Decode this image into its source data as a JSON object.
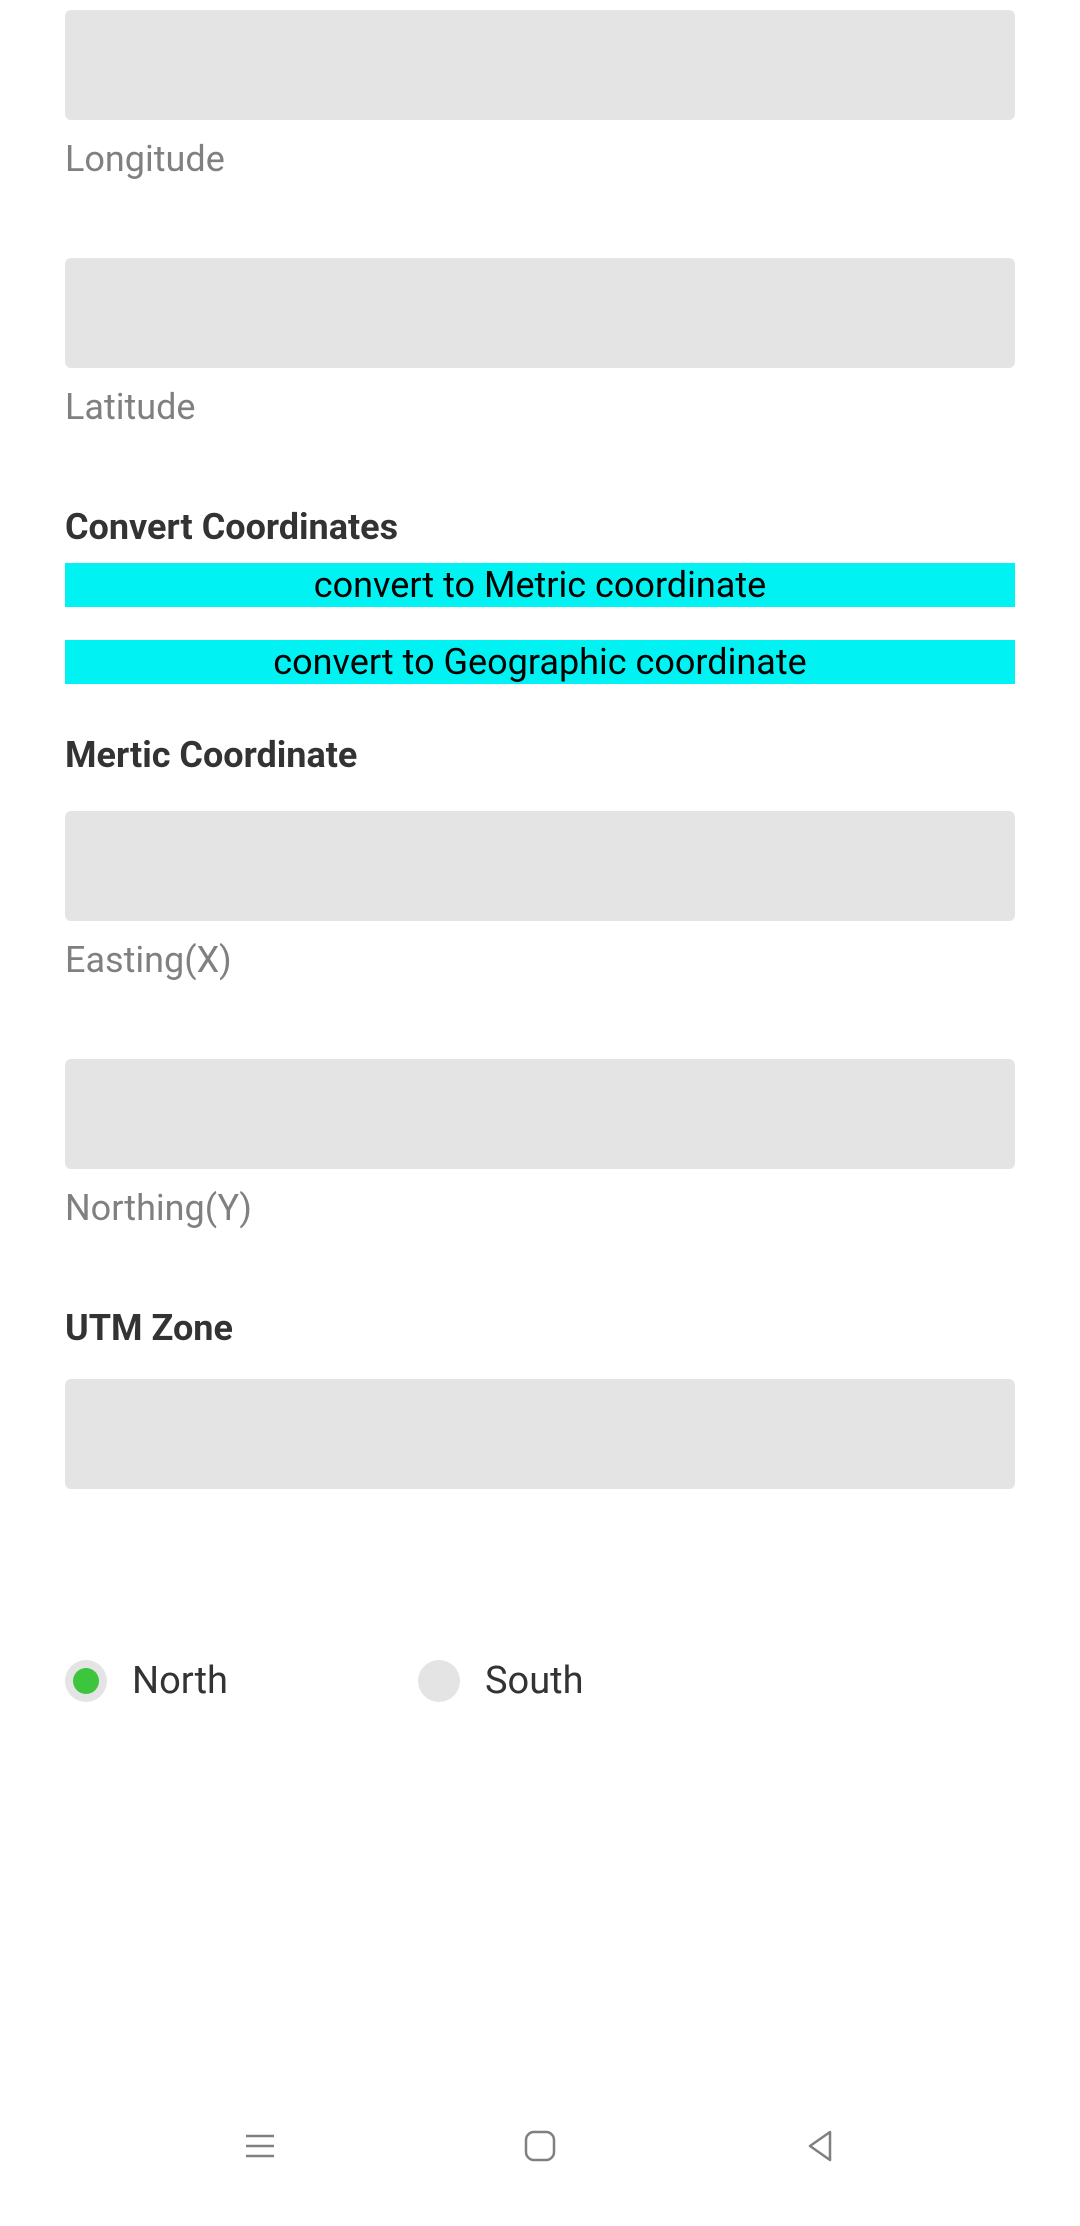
{
  "geographic": {
    "longitude": {
      "label": "Longitude",
      "value": ""
    },
    "latitude": {
      "label": "Latitude",
      "value": ""
    }
  },
  "convert": {
    "heading": "Convert Coordinates",
    "to_metric_label": "convert to Metric coordinate",
    "to_geographic_label": "convert to Geographic coordinate"
  },
  "metric": {
    "heading": "Mertic Coordinate",
    "easting": {
      "label": "Easting(X)",
      "value": ""
    },
    "northing": {
      "label": "Northing(Y)",
      "value": ""
    }
  },
  "utm": {
    "heading": "UTM Zone",
    "zone": {
      "value": ""
    },
    "hemisphere": {
      "north_label": "North",
      "south_label": "South",
      "selected": "north"
    }
  },
  "colors": {
    "accent_cyan": "#00F2F2",
    "radio_selected": "#3DC53D",
    "input_bg": "#E4E4E4"
  }
}
